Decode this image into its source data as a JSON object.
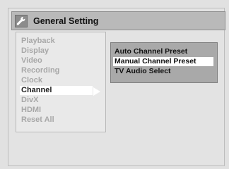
{
  "header": {
    "icon": "wrench-icon",
    "title": "General Setting"
  },
  "menu": {
    "items": [
      {
        "label": "Playback",
        "selected": false
      },
      {
        "label": "Display",
        "selected": false
      },
      {
        "label": "Video",
        "selected": false
      },
      {
        "label": "Recording",
        "selected": false
      },
      {
        "label": "Clock",
        "selected": false
      },
      {
        "label": "Channel",
        "selected": true
      },
      {
        "label": "DivX",
        "selected": false
      },
      {
        "label": "HDMI",
        "selected": false
      },
      {
        "label": "Reset All",
        "selected": false
      }
    ]
  },
  "submenu": {
    "items": [
      {
        "label": "Auto Channel Preset",
        "selected": false
      },
      {
        "label": "Manual Channel Preset",
        "selected": true
      },
      {
        "label": "TV Audio Select",
        "selected": false
      }
    ]
  },
  "colors": {
    "highlight": "#ffffff",
    "inactive_text": "#a8a8a8",
    "active_text": "#111111",
    "title_bar": "#b9b9b9",
    "submenu_bg": "#a9a9a9"
  }
}
